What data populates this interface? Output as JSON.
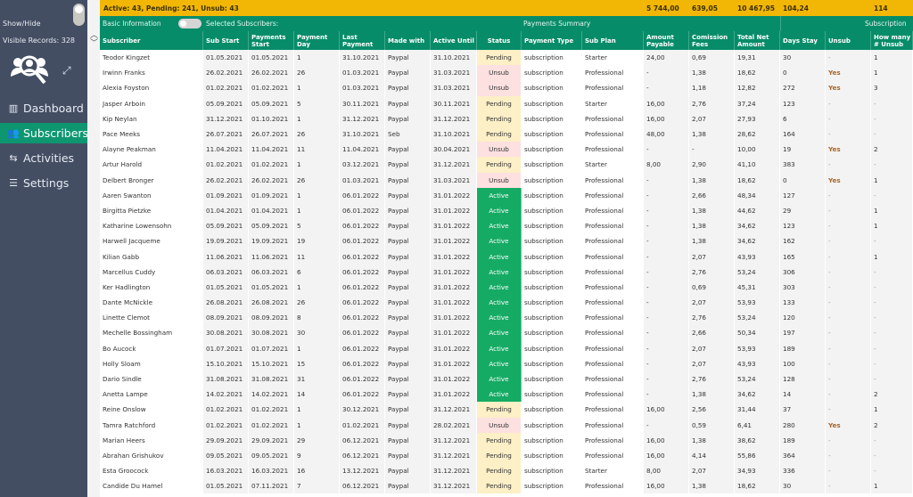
{
  "sidebar": {
    "show_hide": "Show/Hide",
    "visible_records": "Visible Records: 328",
    "items": [
      {
        "label": "Dashboard",
        "icon": "bar-chart-icon"
      },
      {
        "label": "Subscribers",
        "icon": "users-icon",
        "active": true
      },
      {
        "label": "Activities",
        "icon": "arrows-icon"
      },
      {
        "label": "Settings",
        "icon": "sliders-icon"
      }
    ]
  },
  "topbar": {
    "summary": "Active: 43, Pending: 241, Unsub: 43",
    "total_amount": "5 744,00",
    "total_fees": "639,05",
    "total_net": "10 467,95",
    "avg_days": "104,24",
    "total_unsub": "114"
  },
  "band": {
    "basic_info": "Basic Information",
    "selected": "Selected Subscribers:",
    "payments_summary": "Payments Summary",
    "subscription": "Subscription"
  },
  "columns": [
    "Subscriber",
    "Sub Start",
    "Payments Start",
    "Payment Day",
    "Last Payment",
    "Made with",
    "Active Until",
    "Status",
    "Payment Type",
    "Sub Plan",
    "Amount Payable",
    "Comission Fees",
    "Total Net Amount",
    "Days Stay",
    "Unsub",
    "How many # Unsub"
  ],
  "colors": {
    "brand_green": "#078c69",
    "active": "#15ab64",
    "pending": "#fdefc6",
    "unsub": "#fde0e0",
    "topbar": "#f2b705",
    "sidebar": "#434e63"
  },
  "rows": [
    [
      "Teodor Kingzet",
      "01.05.2021",
      "01.05.2021",
      "1",
      "31.10.2021",
      "Paypal",
      "31.10.2021",
      "Pending",
      "subscription",
      "Starter",
      "24,00",
      "0,69",
      "19,31",
      "30",
      "-",
      "1"
    ],
    [
      "Irwinn Franks",
      "26.02.2021",
      "26.02.2021",
      "26",
      "01.03.2021",
      "Paypal",
      "31.03.2021",
      "Unsub",
      "subscription",
      "Professional",
      "-",
      "1,38",
      "18,62",
      "0",
      "Yes",
      "1"
    ],
    [
      "Alexia Foyston",
      "01.02.2021",
      "01.02.2021",
      "1",
      "01.03.2021",
      "Paypal",
      "31.03.2021",
      "Unsub",
      "subscription",
      "Professional",
      "-",
      "1,18",
      "12,82",
      "272",
      "Yes",
      "3"
    ],
    [
      "Jasper Arboin",
      "05.09.2021",
      "05.09.2021",
      "5",
      "30.11.2021",
      "Paypal",
      "30.11.2021",
      "Pending",
      "subscription",
      "Starter",
      "16,00",
      "2,76",
      "37,24",
      "123",
      "-",
      "-"
    ],
    [
      "Kip Neylan",
      "31.12.2021",
      "01.10.2021",
      "1",
      "31.12.2021",
      "Paypal",
      "31.12.2021",
      "Pending",
      "subscription",
      "Professional",
      "16,00",
      "2,07",
      "27,93",
      "6",
      "-",
      "-"
    ],
    [
      "Pace Meeks",
      "26.07.2021",
      "26.07.2021",
      "26",
      "31.10.2021",
      "Seb",
      "31.10.2021",
      "Pending",
      "subscription",
      "Professional",
      "48,00",
      "1,38",
      "28,62",
      "164",
      "-",
      "-"
    ],
    [
      "Alayne Peakman",
      "11.04.2021",
      "11.04.2021",
      "11",
      "11.04.2021",
      "Paypal",
      "30.04.2021",
      "Unsub",
      "subscription",
      "Professional",
      "-",
      "-",
      "10,00",
      "19",
      "Yes",
      "2"
    ],
    [
      "Artur Harold",
      "01.02.2021",
      "01.02.2021",
      "1",
      "03.12.2021",
      "Paypal",
      "31.12.2021",
      "Pending",
      "subscription",
      "Starter",
      "8,00",
      "2,90",
      "41,10",
      "383",
      "-",
      "-"
    ],
    [
      "Delbert Bronger",
      "26.02.2021",
      "26.02.2021",
      "26",
      "01.03.2021",
      "Paypal",
      "31.03.2021",
      "Unsub",
      "subscription",
      "Professional",
      "-",
      "1,38",
      "18,62",
      "0",
      "Yes",
      "1"
    ],
    [
      "Aaren Swanton",
      "01.09.2021",
      "01.09.2021",
      "1",
      "06.01.2022",
      "Paypal",
      "31.01.2022",
      "Active",
      "subscription",
      "Professional",
      "-",
      "2,66",
      "48,34",
      "127",
      "-",
      "-"
    ],
    [
      "Birgitta Pietzke",
      "01.04.2021",
      "01.04.2021",
      "1",
      "06.01.2022",
      "Paypal",
      "31.01.2022",
      "Active",
      "subscription",
      "Professional",
      "-",
      "1,38",
      "44,62",
      "29",
      "-",
      "1"
    ],
    [
      "Katharine Lowensohn",
      "05.09.2021",
      "05.09.2021",
      "5",
      "06.01.2022",
      "Paypal",
      "31.01.2022",
      "Active",
      "subscription",
      "Professional",
      "-",
      "1,38",
      "34,62",
      "123",
      "-",
      "1"
    ],
    [
      "Harwell Jacqueme",
      "19.09.2021",
      "19.09.2021",
      "19",
      "06.01.2022",
      "Paypal",
      "31.01.2022",
      "Active",
      "subscription",
      "Professional",
      "-",
      "1,38",
      "34,62",
      "162",
      "-",
      "-"
    ],
    [
      "Kilian Gabb",
      "11.06.2021",
      "11.06.2021",
      "11",
      "06.01.2022",
      "Paypal",
      "31.01.2022",
      "Active",
      "subscription",
      "Professional",
      "-",
      "2,07",
      "43,93",
      "165",
      "-",
      "1"
    ],
    [
      "Marcellus Cuddy",
      "06.03.2021",
      "06.03.2021",
      "6",
      "06.01.2022",
      "Paypal",
      "31.01.2022",
      "Active",
      "subscription",
      "Professional",
      "-",
      "2,76",
      "53,24",
      "306",
      "-",
      "-"
    ],
    [
      "Ker Hadlington",
      "01.05.2021",
      "01.05.2021",
      "1",
      "06.01.2022",
      "Paypal",
      "31.01.2022",
      "Active",
      "subscription",
      "Professional",
      "-",
      "0,69",
      "45,31",
      "303",
      "-",
      "-"
    ],
    [
      "Dante McNickle",
      "26.08.2021",
      "26.08.2021",
      "26",
      "06.01.2022",
      "Paypal",
      "31.01.2022",
      "Active",
      "subscription",
      "Professional",
      "-",
      "2,07",
      "53,93",
      "133",
      "-",
      "-"
    ],
    [
      "Linette Clemot",
      "08.09.2021",
      "08.09.2021",
      "8",
      "06.01.2022",
      "Paypal",
      "31.01.2022",
      "Active",
      "subscription",
      "Professional",
      "-",
      "2,76",
      "53,24",
      "120",
      "-",
      "-"
    ],
    [
      "Mechelle Bossingham",
      "30.08.2021",
      "30.08.2021",
      "30",
      "06.01.2022",
      "Paypal",
      "31.01.2022",
      "Active",
      "subscription",
      "Professional",
      "-",
      "2,66",
      "50,34",
      "197",
      "-",
      "-"
    ],
    [
      "Bo Aucock",
      "01.07.2021",
      "01.07.2021",
      "1",
      "06.01.2022",
      "Paypal",
      "31.01.2022",
      "Active",
      "subscription",
      "Professional",
      "-",
      "2,07",
      "53,93",
      "189",
      "-",
      "-"
    ],
    [
      "Holly Sloam",
      "15.10.2021",
      "15.10.2021",
      "15",
      "06.01.2022",
      "Paypal",
      "31.01.2022",
      "Active",
      "subscription",
      "Professional",
      "-",
      "2,07",
      "43,93",
      "100",
      "-",
      "-"
    ],
    [
      "Dario Sindle",
      "31.08.2021",
      "31.08.2021",
      "31",
      "06.01.2022",
      "Paypal",
      "31.01.2022",
      "Active",
      "subscription",
      "Professional",
      "-",
      "2,76",
      "53,24",
      "128",
      "-",
      "-"
    ],
    [
      "Anetta Lampe",
      "14.02.2021",
      "14.02.2021",
      "14",
      "06.01.2022",
      "Paypal",
      "31.01.2022",
      "Active",
      "subscription",
      "Professional",
      "-",
      "1,38",
      "34,62",
      "14",
      "-",
      "2"
    ],
    [
      "Reine Onslow",
      "01.02.2021",
      "01.02.2021",
      "1",
      "30.12.2021",
      "Paypal",
      "31.12.2021",
      "Pending",
      "subscription",
      "Professional",
      "16,00",
      "2,56",
      "31,44",
      "37",
      "-",
      "1"
    ],
    [
      "Tamra Ratchford",
      "01.02.2021",
      "01.02.2021",
      "1",
      "01.02.2021",
      "Paypal",
      "28.02.2021",
      "Unsub",
      "subscription",
      "Professional",
      "-",
      "0,59",
      "6,41",
      "280",
      "Yes",
      "2"
    ],
    [
      "Marian Heers",
      "29.09.2021",
      "29.09.2021",
      "29",
      "06.12.2021",
      "Paypal",
      "31.12.2021",
      "Pending",
      "subscription",
      "Professional",
      "16,00",
      "1,38",
      "38,62",
      "189",
      "-",
      "-"
    ],
    [
      "Abrahan Grishukov",
      "09.05.2021",
      "09.05.2021",
      "9",
      "06.12.2021",
      "Paypal",
      "31.12.2021",
      "Pending",
      "subscription",
      "Professional",
      "16,00",
      "4,14",
      "55,86",
      "364",
      "-",
      "-"
    ],
    [
      "Esta Groocock",
      "16.03.2021",
      "16.03.2021",
      "16",
      "13.12.2021",
      "Paypal",
      "31.12.2021",
      "Pending",
      "subscription",
      "Starter",
      "8,00",
      "2,07",
      "34,93",
      "336",
      "-",
      "-"
    ],
    [
      "Candide Du Hamel",
      "01.05.2021",
      "07.11.2021",
      "7",
      "06.12.2021",
      "Paypal",
      "31.12.2021",
      "Pending",
      "subscription",
      "Professional",
      "16,00",
      "1,38",
      "18,62",
      "30",
      "-",
      "1"
    ]
  ]
}
